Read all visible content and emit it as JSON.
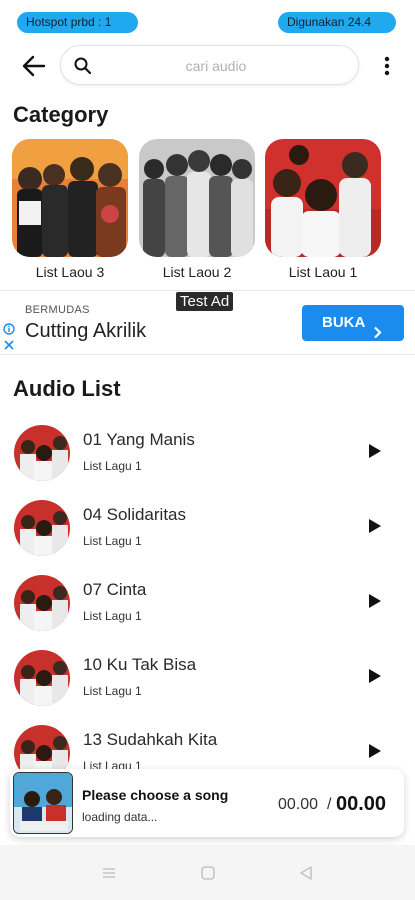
{
  "status": {
    "hotspot_label": "Hotspot prbd : 1",
    "usage_label": "Digunakan 24.4"
  },
  "search": {
    "placeholder": "cari audio",
    "value": ""
  },
  "icons": {
    "back": "arrow-left-icon",
    "search": "magnifier-icon",
    "menu": "more-vertical-icon",
    "play": "play-triangle-icon",
    "ad_info": "info-icon",
    "ad_close": "close-x-icon",
    "ad_chevron": "chevron-right-icon"
  },
  "colors": {
    "pill": "#21a9f0",
    "ad_button": "#1a8cf0",
    "background": "#ffffff"
  },
  "category": {
    "title": "Category",
    "items": [
      {
        "label": "List Laou 3"
      },
      {
        "label": "List Laou 2"
      },
      {
        "label": "List Laou 1"
      }
    ]
  },
  "ad": {
    "badge": "Test Ad",
    "brand": "BERMUDAS",
    "headline": "Cutting Akrilik",
    "cta": "BUKA"
  },
  "audio": {
    "title": "Audio List",
    "items": [
      {
        "title": "01 Yang Manis",
        "sub": "List Lagu 1"
      },
      {
        "title": "04 Solidaritas",
        "sub": "List Lagu 1"
      },
      {
        "title": "07 Cinta",
        "sub": "List Lagu 1"
      },
      {
        "title": "10 Ku Tak Bisa",
        "sub": "List Lagu 1"
      },
      {
        "title": "13 Sudahkah Kita",
        "sub": "List Lagu 1"
      }
    ]
  },
  "player": {
    "title": "Please choose a song",
    "status": "loading data...",
    "current_time": "00.00",
    "separator": "/",
    "total_time": "00.00"
  }
}
